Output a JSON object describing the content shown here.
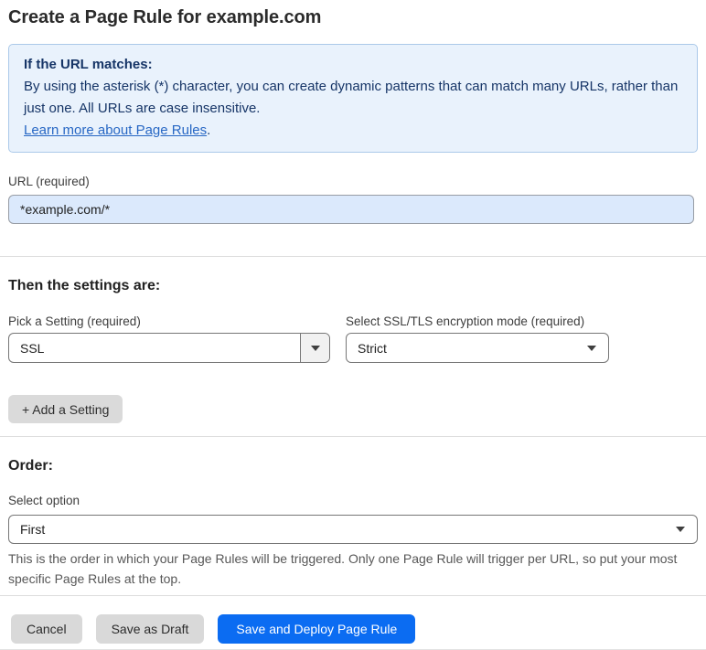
{
  "page": {
    "title": "Create a Page Rule for example.com"
  },
  "info_box": {
    "heading": "If the URL matches:",
    "body": "By using the asterisk (*) character, you can create dynamic patterns that can match many URLs, rather than just one. All URLs are case insensitive.",
    "link_label": "Learn more about Page Rules",
    "link_suffix": "."
  },
  "url_field": {
    "label": "URL (required)",
    "value": "*example.com/*"
  },
  "settings_section": {
    "heading": "Then the settings are:",
    "setting_select": {
      "label": "Pick a Setting (required)",
      "value": "SSL"
    },
    "mode_select": {
      "label": "Select SSL/TLS encryption mode (required)",
      "value": "Strict"
    },
    "add_setting_label": "+ Add a Setting"
  },
  "order_section": {
    "heading": "Order:",
    "select_label": "Select option",
    "value": "First",
    "help_text": "This is the order in which your Page Rules will be triggered. Only one Page Rule will trigger per URL, so put your most specific Page Rules at the top."
  },
  "actions": {
    "cancel_label": "Cancel",
    "save_draft_label": "Save as Draft",
    "save_deploy_label": "Save and Deploy Page Rule"
  },
  "icons": {
    "select_caret": "caret-down-icon"
  },
  "colors": {
    "info_box_bg": "#e9f2fc",
    "info_box_border": "#abc9e9",
    "info_text_navy": "#163567",
    "link_blue": "#2767c4",
    "url_input_bg": "#dbe9fc",
    "primary_button_blue": "#0b6cf2",
    "secondary_button_gray": "#d9d9d9",
    "title_text": "#2b2b2b"
  }
}
